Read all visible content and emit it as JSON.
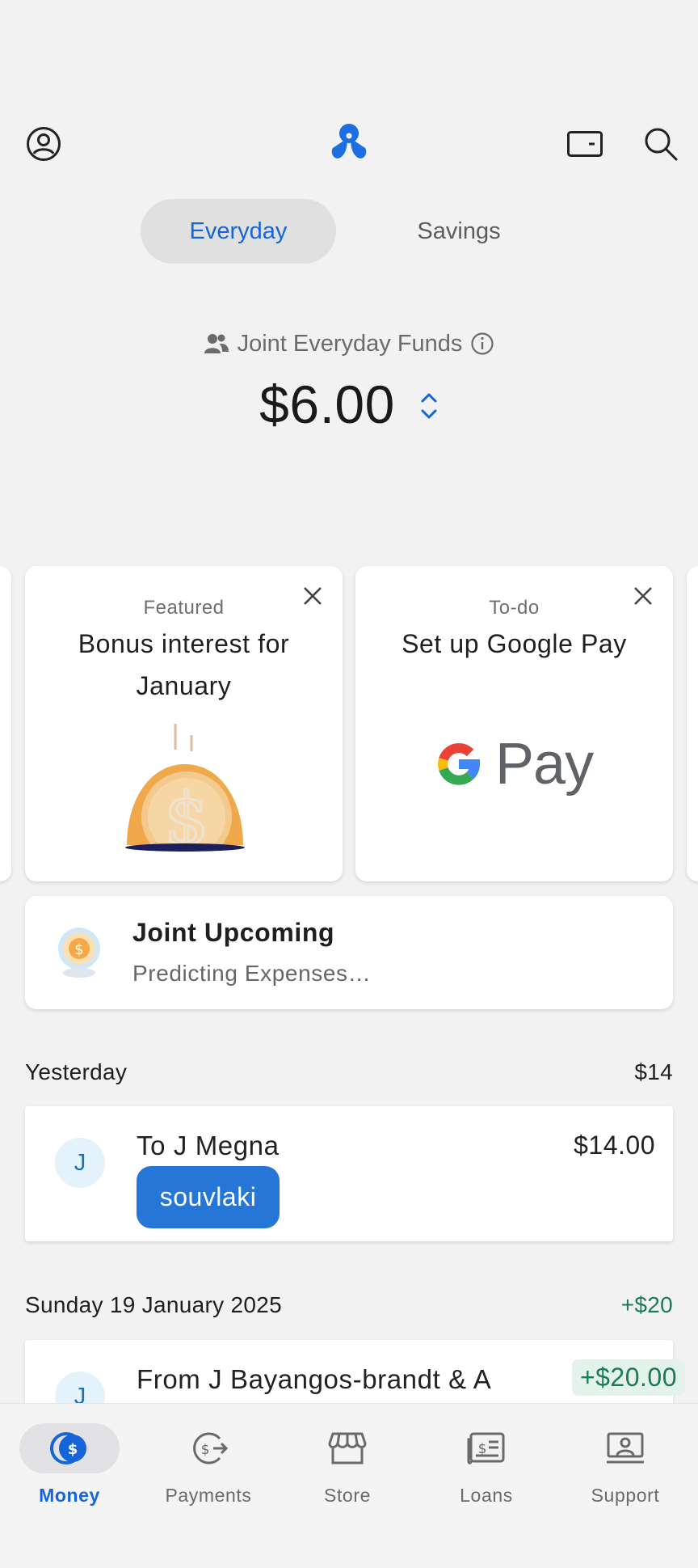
{
  "header": {
    "profile_icon": "profile-icon",
    "logo_icon": "up-logo-icon",
    "card_icon": "card-icon",
    "search_icon": "search-icon"
  },
  "tabs": [
    {
      "label": "Everyday",
      "active": true
    },
    {
      "label": "Savings",
      "active": false
    }
  ],
  "account": {
    "label": "Joint Everyday Funds",
    "balance": "$6.00"
  },
  "cards": [
    {
      "eyebrow": "Featured",
      "title": "Bonus interest for January"
    },
    {
      "eyebrow": "To-do",
      "title": "Set up Google Pay",
      "logo_text": "Pay"
    }
  ],
  "upcoming": {
    "title": "Joint Upcoming",
    "subtitle": "Predicting Expenses…"
  },
  "sections": [
    {
      "date": "Yesterday",
      "total": "$14",
      "transactions": [
        {
          "avatar": "J",
          "name": "To J Megna",
          "amount": "$14.00",
          "tag": "souvlaki"
        }
      ]
    },
    {
      "date": "Sunday 19 January 2025",
      "total": "+$20",
      "transactions": [
        {
          "avatar": "J",
          "name": "From J Bayangos-brandt & A",
          "amount": "+$20.00"
        }
      ]
    }
  ],
  "bottom_nav": [
    {
      "label": "Money",
      "icon": "money-icon",
      "active": true
    },
    {
      "label": "Payments",
      "icon": "payments-icon",
      "active": false
    },
    {
      "label": "Store",
      "icon": "store-icon",
      "active": false
    },
    {
      "label": "Loans",
      "icon": "loans-icon",
      "active": false
    },
    {
      "label": "Support",
      "icon": "support-icon",
      "active": false
    }
  ],
  "colors": {
    "accent": "#1565d8",
    "positive": "#1d7a59",
    "tag_bg": "#2576d6",
    "background": "#f2f2f3"
  }
}
